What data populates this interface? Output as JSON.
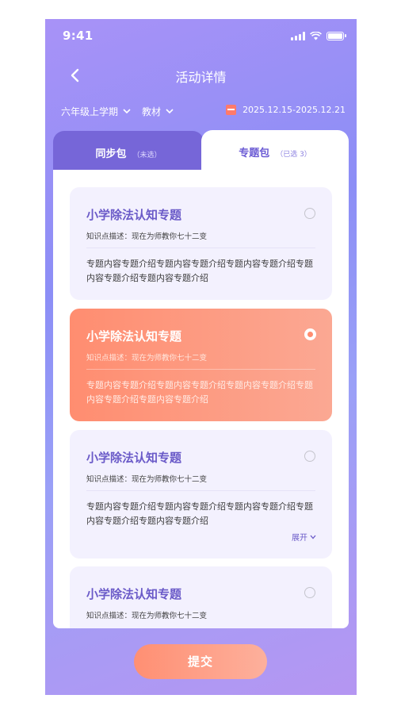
{
  "status_bar": {
    "time": "9:41"
  },
  "header": {
    "title": "活动详情"
  },
  "filters": [
    {
      "label": "六年级上学期"
    },
    {
      "label": "教材"
    }
  ],
  "date_range": "2025.12.15-2025.12.21",
  "tabs": [
    {
      "label": "同步包",
      "sub": "（未选）"
    },
    {
      "label": "专题包",
      "sub": "（已选 3）"
    }
  ],
  "cards": [
    {
      "title": "小学除法认知专题",
      "desc": "知识点描述：现在为师教你七十二变",
      "body": "专题内容专题介绍专题内容专题介绍专题内容专题介绍专题内容专题介绍专题内容专题介绍",
      "selected": false
    },
    {
      "title": "小学除法认知专题",
      "desc": "知识点描述：现在为师教你七十二变",
      "body": "专题内容专题介绍专题内容专题介绍专题内容专题介绍专题内容专题介绍专题内容专题介绍",
      "selected": true
    },
    {
      "title": "小学除法认知专题",
      "desc": "知识点描述：现在为师教你七十二变",
      "body": "专题内容专题介绍专题内容专题介绍专题内容专题介绍专题内容专题介绍专题内容专题介绍",
      "selected": false,
      "expand_label": "展开"
    },
    {
      "title": "小学除法认知专题",
      "desc": "知识点描述：现在为师教你七十二变",
      "body": "",
      "selected": false
    }
  ],
  "submit_label": "提交",
  "colors": {
    "accent": "#6b5bd4",
    "selected": "#ff8d70",
    "background_top": "#a892f7"
  },
  "icons": [
    "back-icon",
    "chevron-down-icon",
    "calendar-icon",
    "signal-icon",
    "wifi-icon",
    "battery-icon",
    "radio-icon"
  ]
}
